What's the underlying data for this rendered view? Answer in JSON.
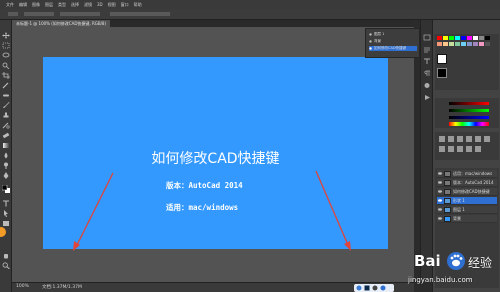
{
  "menubar": {
    "items": [
      "文件",
      "编辑",
      "图像",
      "图层",
      "类型",
      "选择",
      "滤镜",
      "3D",
      "视图",
      "窗口",
      "帮助"
    ]
  },
  "document_tab": {
    "label": "未标题-1 @ 100% (如何修改CAD快捷键, RGB/8)"
  },
  "canvas": {
    "title": "如何修改CAD快捷键",
    "version_line": "版本：AutoCad 2014",
    "applies_line": "适用：mac/windows",
    "background_color": "#3399ff",
    "arrow_color": "#e0443a"
  },
  "statusbar": {
    "zoom": "100%",
    "info": "文档:1.37M/1.37M"
  },
  "navigator_panel": {
    "rows": [
      {
        "label": "图层 1"
      },
      {
        "label": "背景"
      },
      {
        "label": "如何修改CAD快捷键"
      }
    ]
  },
  "layers_panel": {
    "layers": [
      {
        "name": "适用：mac/windows"
      },
      {
        "name": "版本：AutoCad 2014"
      },
      {
        "name": "如何修改CAD快捷键"
      },
      {
        "name": "形状 1"
      },
      {
        "name": "图层 1"
      },
      {
        "name": "背景"
      }
    ],
    "selected_index": 3
  },
  "watermark": {
    "brand": "Bai",
    "brand_suffix": "经验",
    "url": "jingyan.baidu.com"
  },
  "icons": {
    "toolbar": [
      "move-icon",
      "marquee-icon",
      "lasso-icon",
      "quick-select-icon",
      "crop-icon",
      "eyedropper-icon",
      "healing-icon",
      "brush-icon",
      "clone-stamp-icon",
      "history-brush-icon",
      "eraser-icon",
      "gradient-icon",
      "blur-icon",
      "dodge-icon",
      "pen-icon",
      "type-icon",
      "path-select-icon",
      "shape-icon",
      "hand-icon",
      "zoom-icon"
    ]
  },
  "colors": {
    "ui_dark": "#3a3a3a",
    "selection": "#2f6fd1",
    "accent_orange": "#f29b27"
  }
}
